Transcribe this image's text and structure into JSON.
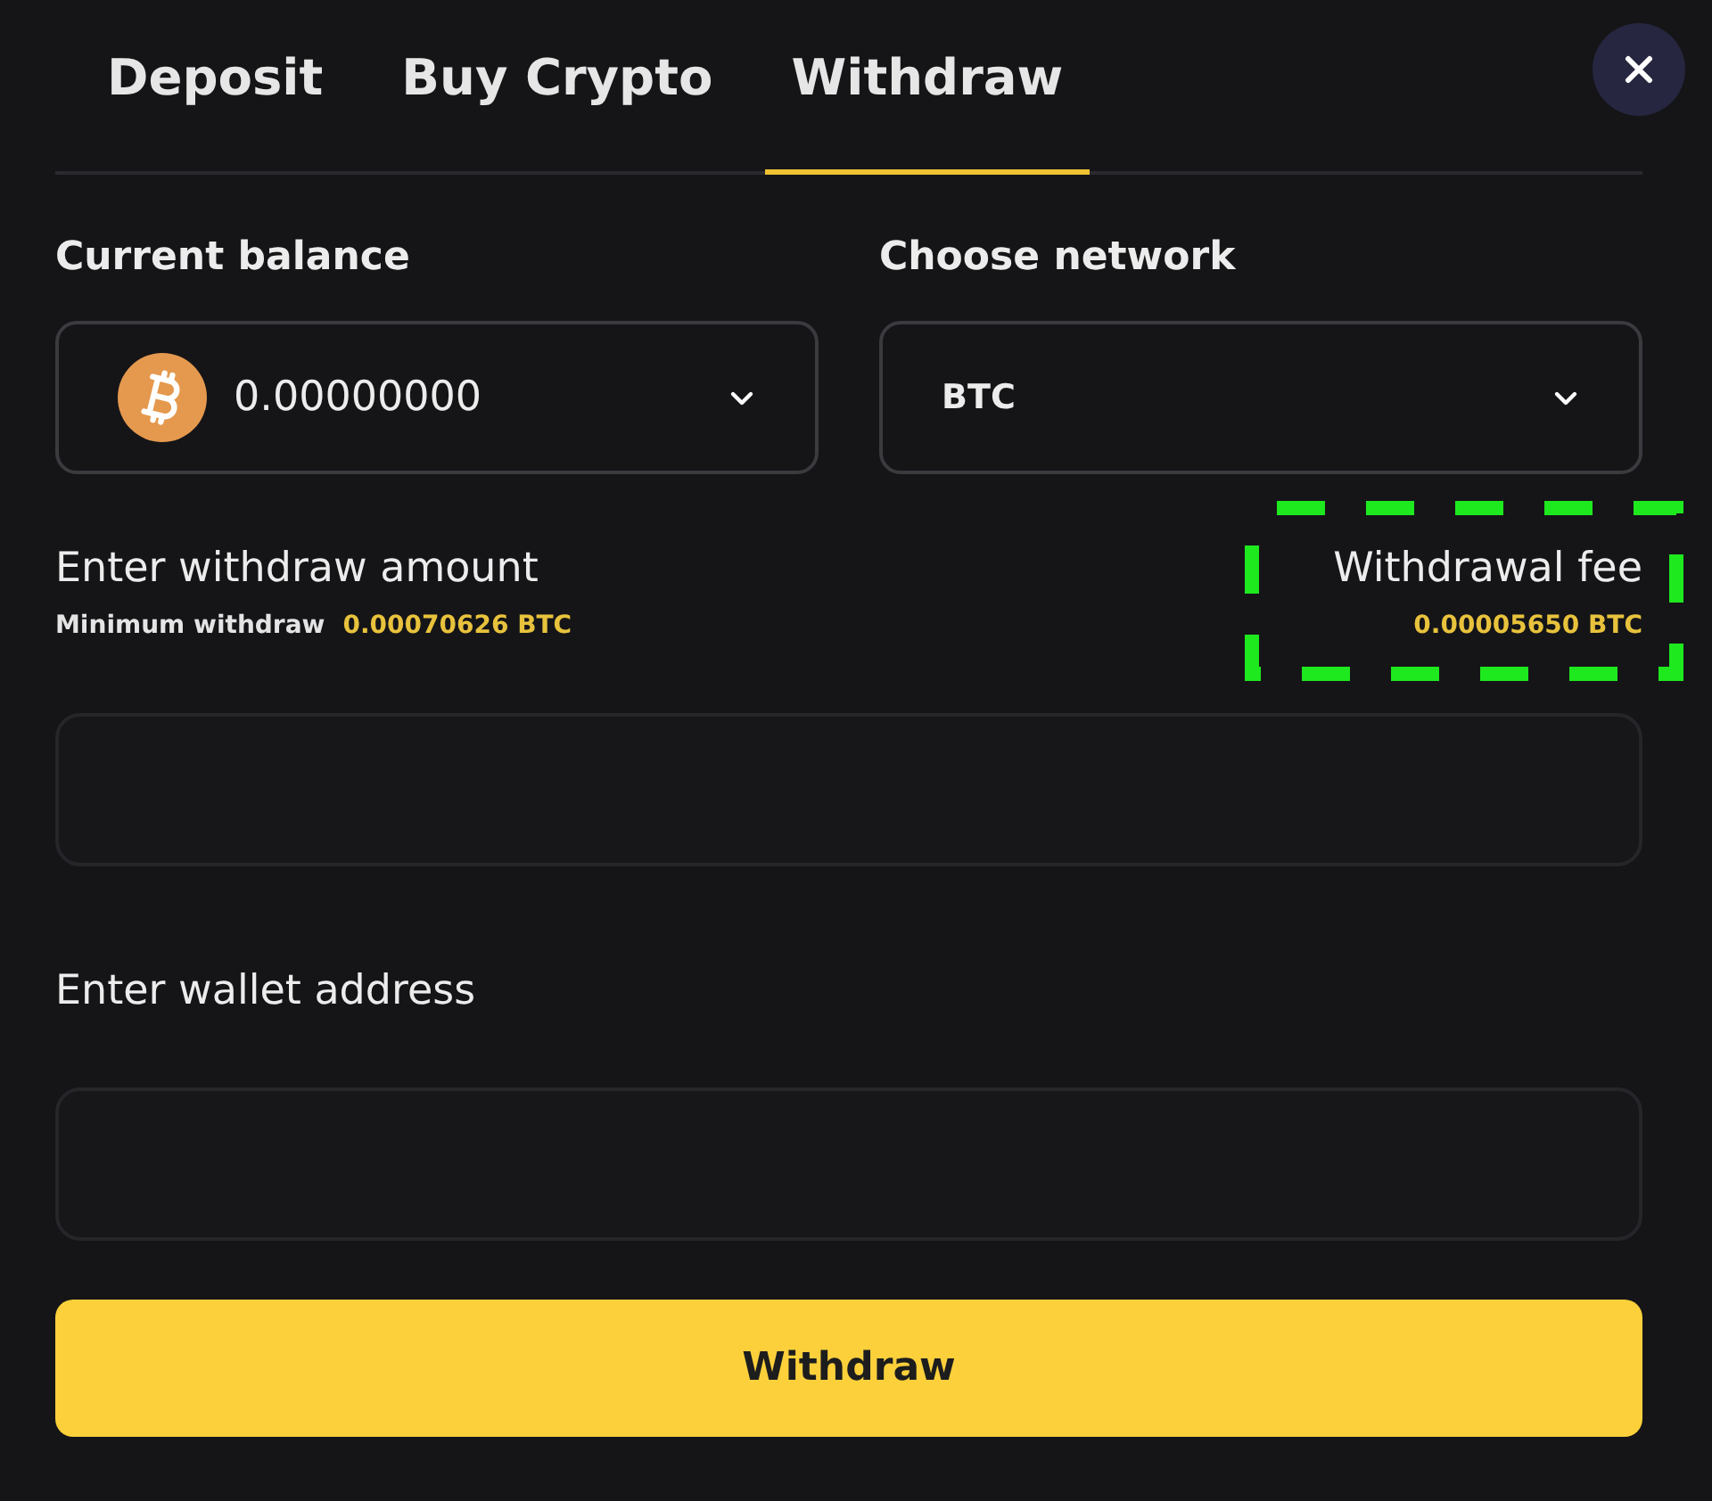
{
  "tabs": [
    {
      "label": "Deposit",
      "selected": false
    },
    {
      "label": "Buy Crypto",
      "selected": false
    },
    {
      "label": "Withdraw",
      "selected": true
    }
  ],
  "balance": {
    "label": "Current balance",
    "value": "0.00000000"
  },
  "network": {
    "label": "Choose network",
    "value": "BTC"
  },
  "amount": {
    "label": "Enter withdraw amount",
    "minimum_label": "Minimum withdraw",
    "minimum_value": "0.00070626 BTC"
  },
  "fee": {
    "label": "Withdrawal fee",
    "value": "0.00005650 BTC",
    "highlighted": true
  },
  "address": {
    "label": "Enter wallet address"
  },
  "submit": {
    "label": "Withdraw"
  }
}
